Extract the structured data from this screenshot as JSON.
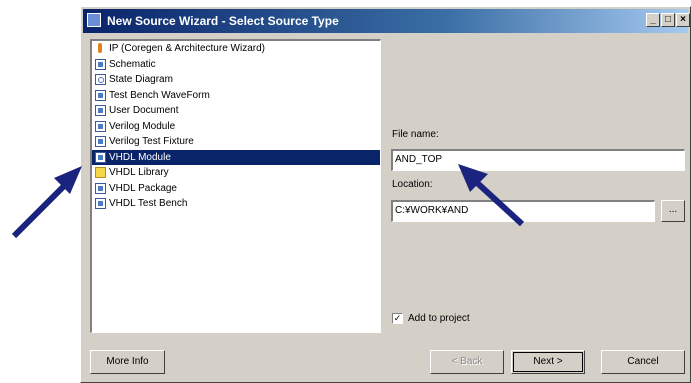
{
  "window": {
    "title": "New Source Wizard - Select Source Type",
    "buttons": {
      "minimize": "_",
      "maximize": "□",
      "close": "×"
    }
  },
  "source_types": [
    {
      "label": "IP (Coregen & Architecture Wizard)",
      "icon": "ip-icon",
      "selected": false
    },
    {
      "label": "Schematic",
      "icon": "schematic-icon",
      "selected": false
    },
    {
      "label": "State Diagram",
      "icon": "state-diagram-icon",
      "selected": false
    },
    {
      "label": "Test Bench WaveForm",
      "icon": "waveform-icon",
      "selected": false
    },
    {
      "label": "User Document",
      "icon": "document-icon",
      "selected": false
    },
    {
      "label": "Verilog Module",
      "icon": "verilog-icon",
      "selected": false
    },
    {
      "label": "Verilog Test Fixture",
      "icon": "verilog-test-icon",
      "selected": false
    },
    {
      "label": "VHDL Module",
      "icon": "vhdl-icon",
      "selected": true
    },
    {
      "label": "VHDL Library",
      "icon": "library-icon",
      "selected": false
    },
    {
      "label": "VHDL Package",
      "icon": "package-icon",
      "selected": false
    },
    {
      "label": "VHDL Test Bench",
      "icon": "testbench-icon",
      "selected": false
    }
  ],
  "file_name": {
    "label": "File name:",
    "value": "AND_TOP"
  },
  "location": {
    "label": "Location:",
    "value": "C:¥WORK¥AND",
    "browse_label": "..."
  },
  "add_to_project": {
    "label": "Add to project",
    "checked": true,
    "mark": "✓"
  },
  "footer": {
    "more_info": "More Info",
    "back": "< Back",
    "next": "Next >",
    "cancel": "Cancel"
  },
  "colors": {
    "selection": "#0a246a",
    "annotation_arrow": "#1a237e"
  }
}
